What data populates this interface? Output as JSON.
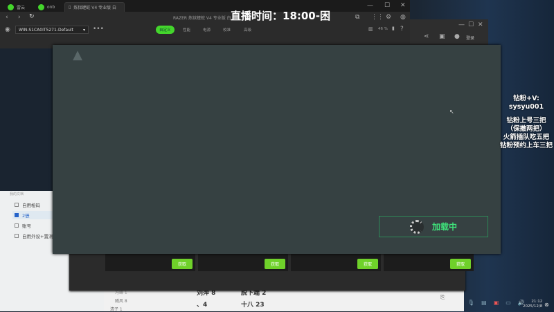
{
  "tabs": [
    {
      "label": "雷云"
    },
    {
      "label": "onb"
    },
    {
      "label": "炼狱蝰蛇 V4 专业版 白"
    }
  ],
  "window_title": "RAZER 炼狱蝰蛇 V4 专业版 白",
  "live_banner": "直播时间：18:00-困",
  "profile": "WIN-S1CA0IT5271-Default",
  "nav": [
    "自定义",
    "性能",
    "电源",
    "校准",
    "高级"
  ],
  "battery": "46 %",
  "login": "登录",
  "logo_text": "三角洲行动",
  "loading": "加载中",
  "left_app": {
    "header": "我的文档",
    "items": [
      "自用枪码",
      "2债",
      "账号",
      "自用外设+置测"
    ],
    "selected": 1
  },
  "get_label": "获取",
  "bottom_texts": [
    "随风 8",
    "清子 1",
    "、4",
    "十八 23",
    "冯峰 1",
    "刘萍 8",
    "脱下端 2"
  ],
  "overlay": [
    "钻粉+V:",
    "sysyu001",
    "",
    "钻粉上号三把",
    "（保撤两把）",
    "火箭插队吃五把",
    "钻粉预约上车三把"
  ],
  "clock": {
    "time": "21:12",
    "date": "2025/12/8"
  },
  "accent": "#44d62c"
}
